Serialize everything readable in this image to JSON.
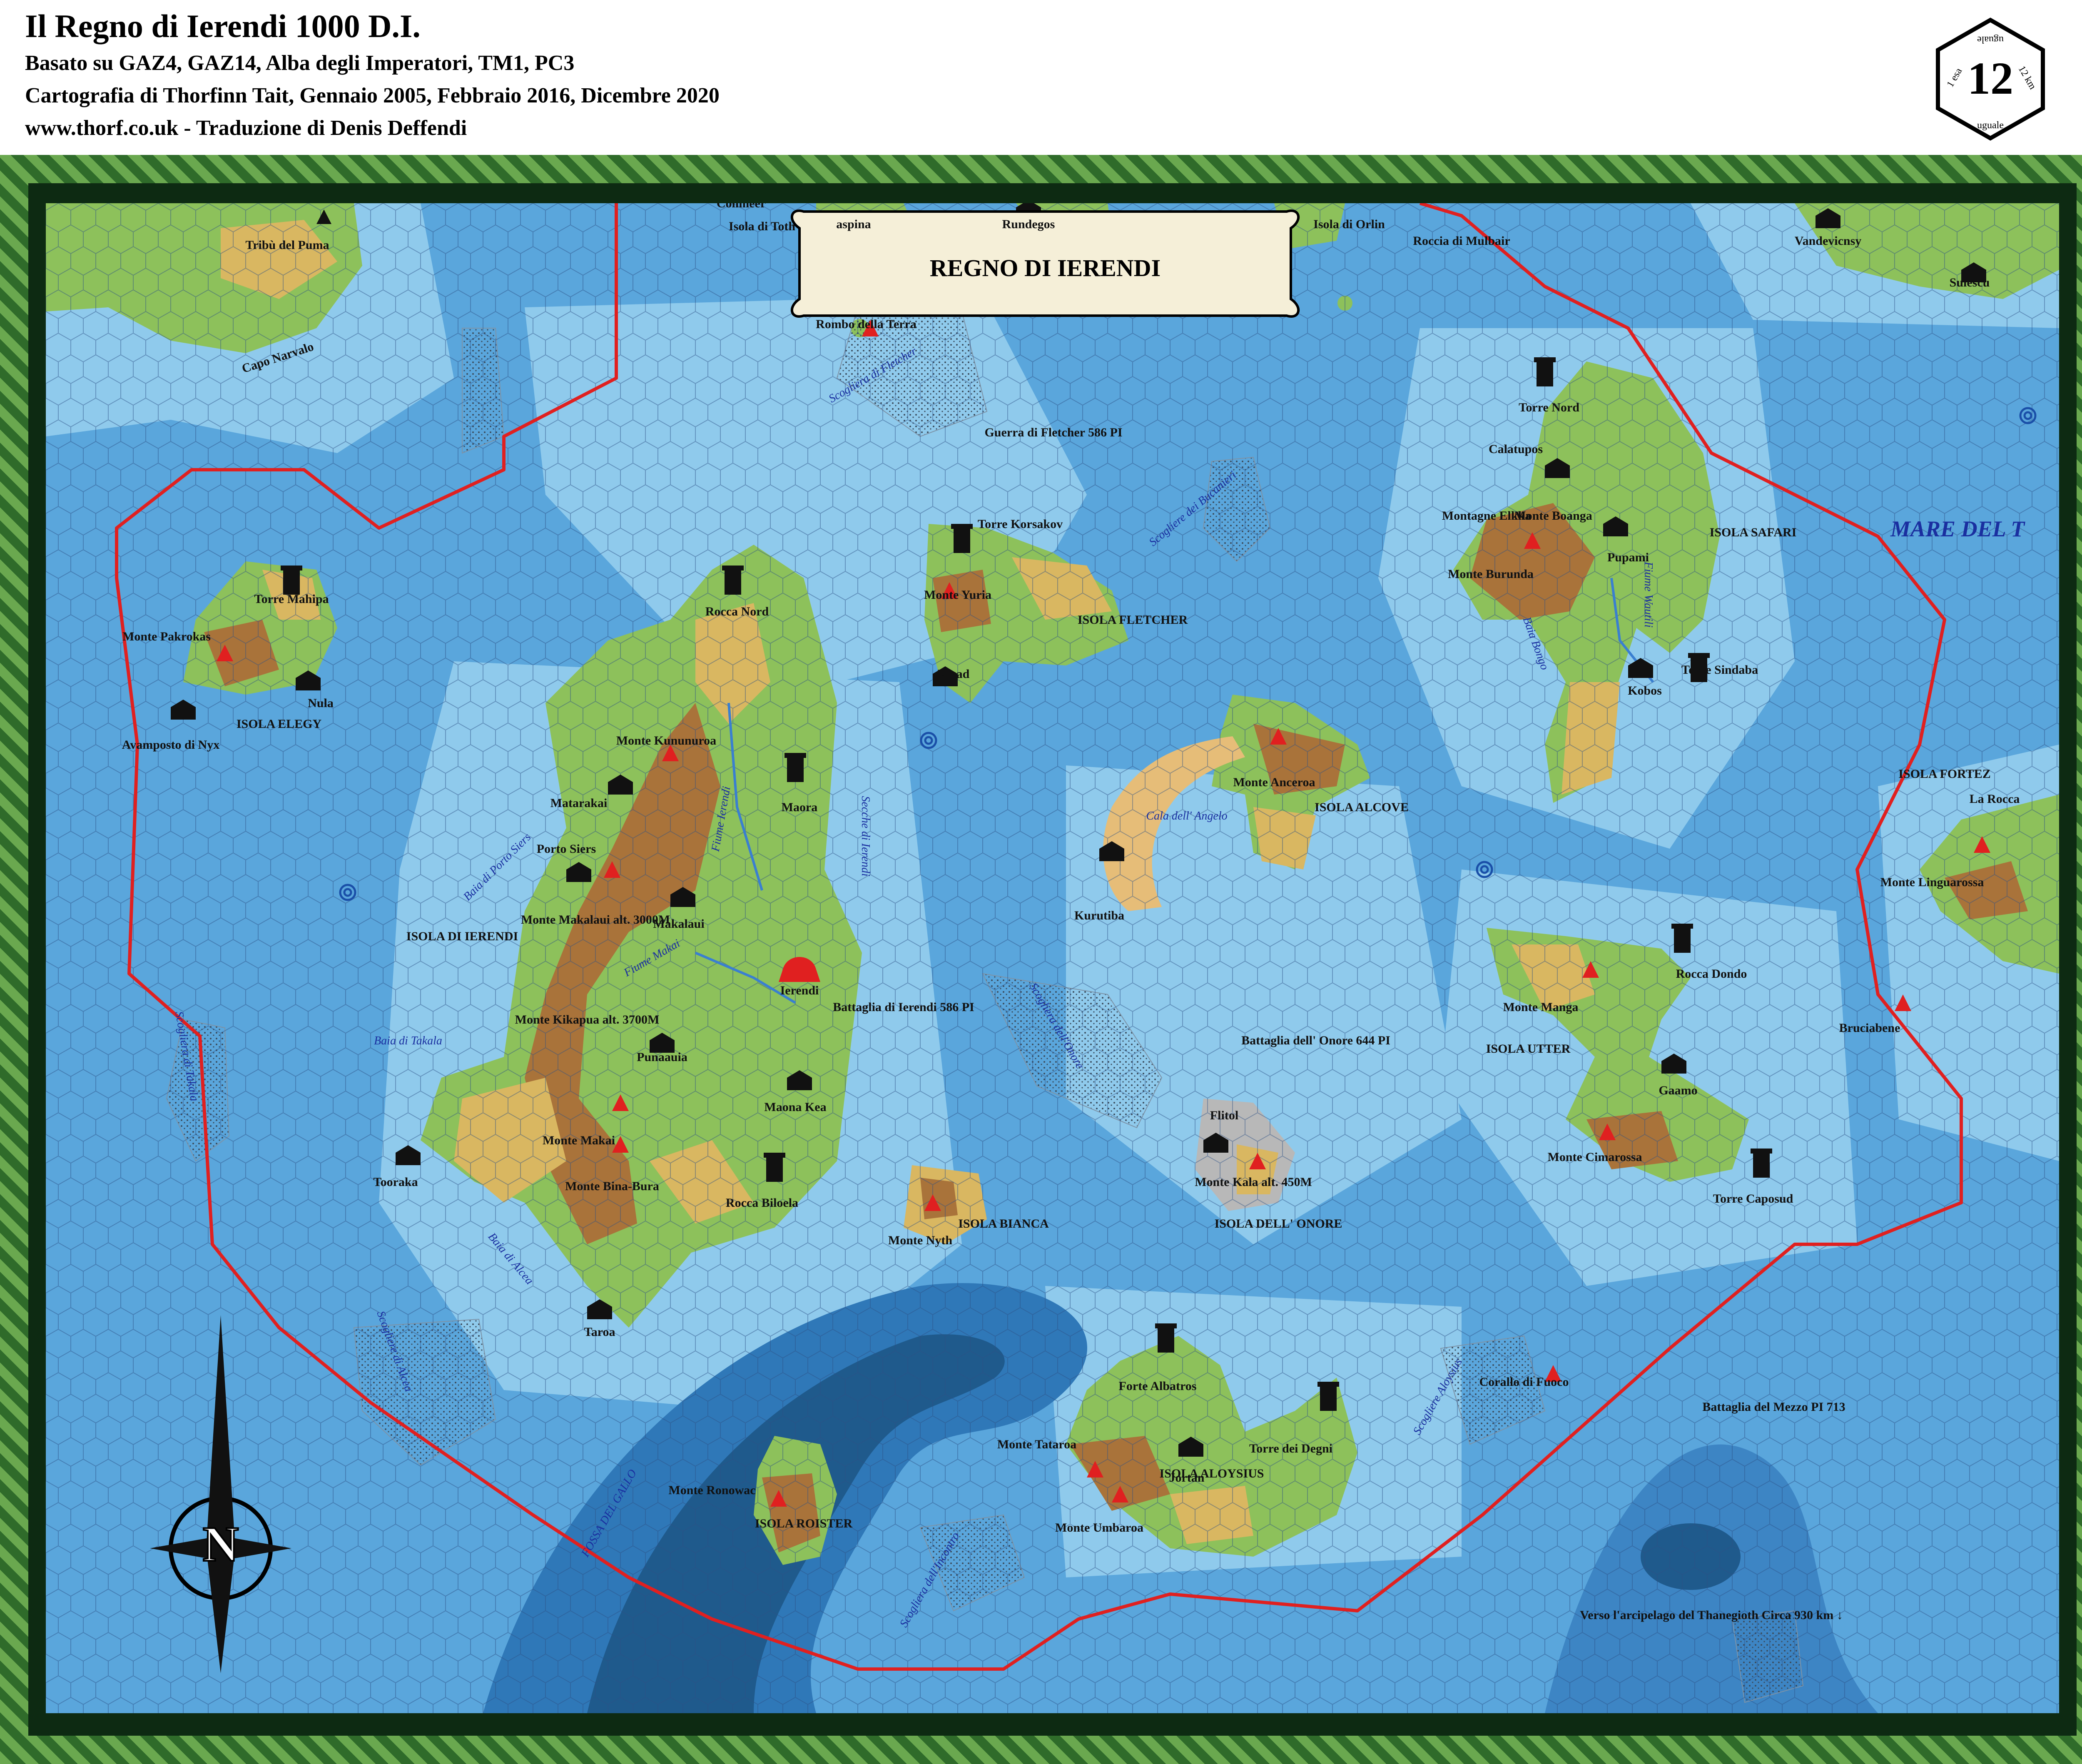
{
  "header": {
    "title": "Il Regno di Ierendi 1000 D.I.",
    "line1": "Basato su GAZ4, GAZ14, Alba degli Imperatori, TM1, PC3",
    "line2": "Cartografia di Thorfinn Tait, Gennaio 2005, Febbraio 2016, Dicembre 2020",
    "line3": "www.thorf.co.uk - Traduzione di Denis Deffendi"
  },
  "scale": {
    "value": "12",
    "unit_top": "1 esa",
    "unit_bottom": "uguale",
    "unit_km": "12 km"
  },
  "cartouche": "REGNO DI IERENDI",
  "sea_label": "MARE DEL T",
  "places": [
    {
      "id": "tribu-puma",
      "text": "Tribù del Puma"
    },
    {
      "id": "capo-narvalo",
      "text": "Capo Narvalo"
    },
    {
      "id": "colimeer",
      "text": "Colimeer"
    },
    {
      "id": "isola-toth",
      "text": "Isola di Toth"
    },
    {
      "id": "aspina",
      "text": "aspina"
    },
    {
      "id": "rundegos",
      "text": "Rundegos"
    },
    {
      "id": "isola-orlin",
      "text": "Isola di Orlin"
    },
    {
      "id": "roccia-mulbair",
      "text": "Roccia di Mulbair"
    },
    {
      "id": "vandevicnsy",
      "text": "Vandevicnsy"
    },
    {
      "id": "sulescu",
      "text": "Sulescu"
    },
    {
      "id": "rombo-terra",
      "text": "Rombo della Terra"
    },
    {
      "id": "guerra-fletcher",
      "text": "Guerra di Fletcher 586 PI"
    },
    {
      "id": "torre-nord",
      "text": "Torre Nord"
    },
    {
      "id": "calatupos",
      "text": "Calatupos"
    },
    {
      "id": "montagne-elkka",
      "text": "Montagne Elkka"
    },
    {
      "id": "monte-boanga",
      "text": "Monte Boanga"
    },
    {
      "id": "pupami",
      "text": "Pupami"
    },
    {
      "id": "isola-safari",
      "text": "ISOLA SAFARI"
    },
    {
      "id": "monte-burunda",
      "text": "Monte Burunda"
    },
    {
      "id": "kobos",
      "text": "Kobos"
    },
    {
      "id": "torre-sindaba",
      "text": "Torre Sindaba"
    },
    {
      "id": "torre-korsakov",
      "text": "Torre Korsakov"
    },
    {
      "id": "monte-yuria",
      "text": "Monte Yuria"
    },
    {
      "id": "isola-fletcher",
      "text": "ISOLA FLETCHER"
    },
    {
      "id": "vlaad",
      "text": "Vlaad"
    },
    {
      "id": "torre-mahipa",
      "text": "Torre Mahipa"
    },
    {
      "id": "monte-pakrokas",
      "text": "Monte Pakrokas"
    },
    {
      "id": "nula",
      "text": "Nula"
    },
    {
      "id": "avamposto-nyx",
      "text": "Avamposto di Nyx"
    },
    {
      "id": "isola-elegy",
      "text": "ISOLA ELEGY"
    },
    {
      "id": "rocca-nord",
      "text": "Rocca Nord"
    },
    {
      "id": "monte-kununuroa",
      "text": "Monte Kununuroa"
    },
    {
      "id": "matarakai",
      "text": "Matarakai"
    },
    {
      "id": "maora",
      "text": "Maora"
    },
    {
      "id": "porto-siers",
      "text": "Porto Siers"
    },
    {
      "id": "monte-makalaui",
      "text": "Monte Makalaui alt. 3000M"
    },
    {
      "id": "makalaui",
      "text": "Makalaui"
    },
    {
      "id": "isola-ierendi",
      "text": "ISOLA DI IERENDI"
    },
    {
      "id": "ierendi",
      "text": "Ierendi"
    },
    {
      "id": "battaglia-ierendi",
      "text": "Battaglia di Ierendi 586 PI"
    },
    {
      "id": "monte-kikapua",
      "text": "Monte Kikapua alt. 3700M"
    },
    {
      "id": "punaauia",
      "text": "Punaauia"
    },
    {
      "id": "maona-kea",
      "text": "Maona Kea"
    },
    {
      "id": "monte-makai",
      "text": "Monte Makai"
    },
    {
      "id": "tooraka",
      "text": "Tooraka"
    },
    {
      "id": "monte-bina-bura",
      "text": "Monte Bina-Bura"
    },
    {
      "id": "rocca-biloela",
      "text": "Rocca Biloela"
    },
    {
      "id": "taroa",
      "text": "Taroa"
    },
    {
      "id": "monte-nyth",
      "text": "Monte Nyth"
    },
    {
      "id": "isola-bianca",
      "text": "ISOLA BIANCA"
    },
    {
      "id": "monte-anceroa",
      "text": "Monte Anceroa"
    },
    {
      "id": "isola-alcove",
      "text": "ISOLA ALCOVE"
    },
    {
      "id": "kurutiba",
      "text": "Kurutiba"
    },
    {
      "id": "battaglia-onore",
      "text": "Battaglia dell' Onore 644 PI"
    },
    {
      "id": "flitol",
      "text": "Flitol"
    },
    {
      "id": "monte-kala",
      "text": "Monte Kala alt. 450M"
    },
    {
      "id": "isola-onore",
      "text": "ISOLA DELL' ONORE"
    },
    {
      "id": "rocca-dondo",
      "text": "Rocca Dondo"
    },
    {
      "id": "monte-manga",
      "text": "Monte Manga"
    },
    {
      "id": "isola-utter",
      "text": "ISOLA UTTER"
    },
    {
      "id": "gaamo",
      "text": "Gaamo"
    },
    {
      "id": "monte-cimarossa",
      "text": "Monte Cimarossa"
    },
    {
      "id": "torre-caposud",
      "text": "Torre Caposud"
    },
    {
      "id": "isola-fortez",
      "text": "ISOLA FORTEZ"
    },
    {
      "id": "la-rocca",
      "text": "La Rocca"
    },
    {
      "id": "monte-linguarossa",
      "text": "Monte Linguarossa"
    },
    {
      "id": "bruciabene",
      "text": "Bruciabene"
    },
    {
      "id": "forte-albatros",
      "text": "Forte Albatros"
    },
    {
      "id": "monte-tataroa",
      "text": "Monte Tataroa"
    },
    {
      "id": "jortan",
      "text": "Jortan"
    },
    {
      "id": "torre-degni",
      "text": "Torre dei Degni"
    },
    {
      "id": "isola-aloysius",
      "text": "ISOLA ALOYSIUS"
    },
    {
      "id": "monte-umbaroa",
      "text": "Monte Umbaroa"
    },
    {
      "id": "corallo-fuoco",
      "text": "Corallo di Fuoco"
    },
    {
      "id": "battaglia-mezzo",
      "text": "Battaglia del Mezzo PI 713"
    },
    {
      "id": "monte-ronowac",
      "text": "Monte Ronowac"
    },
    {
      "id": "isola-roister",
      "text": "ISOLA ROISTER"
    },
    {
      "id": "verso-thanegioth",
      "text": "Verso l'arcipelago del Thanegioth Circa 930 km ↓"
    }
  ],
  "waters": [
    {
      "id": "scogliera-fletcher",
      "text": "Scogliera di Fletcher"
    },
    {
      "id": "scogliere-bucanieri",
      "text": "Scogliere dei Bucanieri"
    },
    {
      "id": "baia-bongo",
      "text": "Baia Bongo"
    },
    {
      "id": "fiume-wautili",
      "text": "Fiume Wautili"
    },
    {
      "id": "baia-porto-siers",
      "text": "Baia di Porto Siers"
    },
    {
      "id": "fiume-ierendi",
      "text": "Fiume Ierendi"
    },
    {
      "id": "secche-ierendi",
      "text": "Secche di Ierendi"
    },
    {
      "id": "cala-angelo",
      "text": "Cala dell' Angelo"
    },
    {
      "id": "fiume-makai",
      "text": "Fiume Makai"
    },
    {
      "id": "baia-takala",
      "text": "Baia di Takala"
    },
    {
      "id": "scogliera-takala",
      "text": "Scogliera di Takala"
    },
    {
      "id": "scogliera-onore",
      "text": "Scogliera dell'Onore"
    },
    {
      "id": "baia-alcea",
      "text": "Baia di Alcea"
    },
    {
      "id": "scogliere-alcea",
      "text": "Scogliere di Alcea"
    },
    {
      "id": "fossa-gallo",
      "text": "FOSSA DEL GALLO"
    },
    {
      "id": "scogliera-incontro",
      "text": "Scogliera dell'Incontro"
    },
    {
      "id": "scogliere-aloysius",
      "text": "Scogliere Aloysius"
    }
  ],
  "colors": {
    "sea_shallow": "#86c6ea",
    "sea": "#5aa6dc",
    "sea_deep": "#2f78b8",
    "trench": "#1f5a8c",
    "grass": "#8dc15b",
    "hills": "#d9b761",
    "mountains": "#a9733a",
    "border": "#e02020",
    "reef": "#7c93a8",
    "frame": "#6aa84f"
  }
}
